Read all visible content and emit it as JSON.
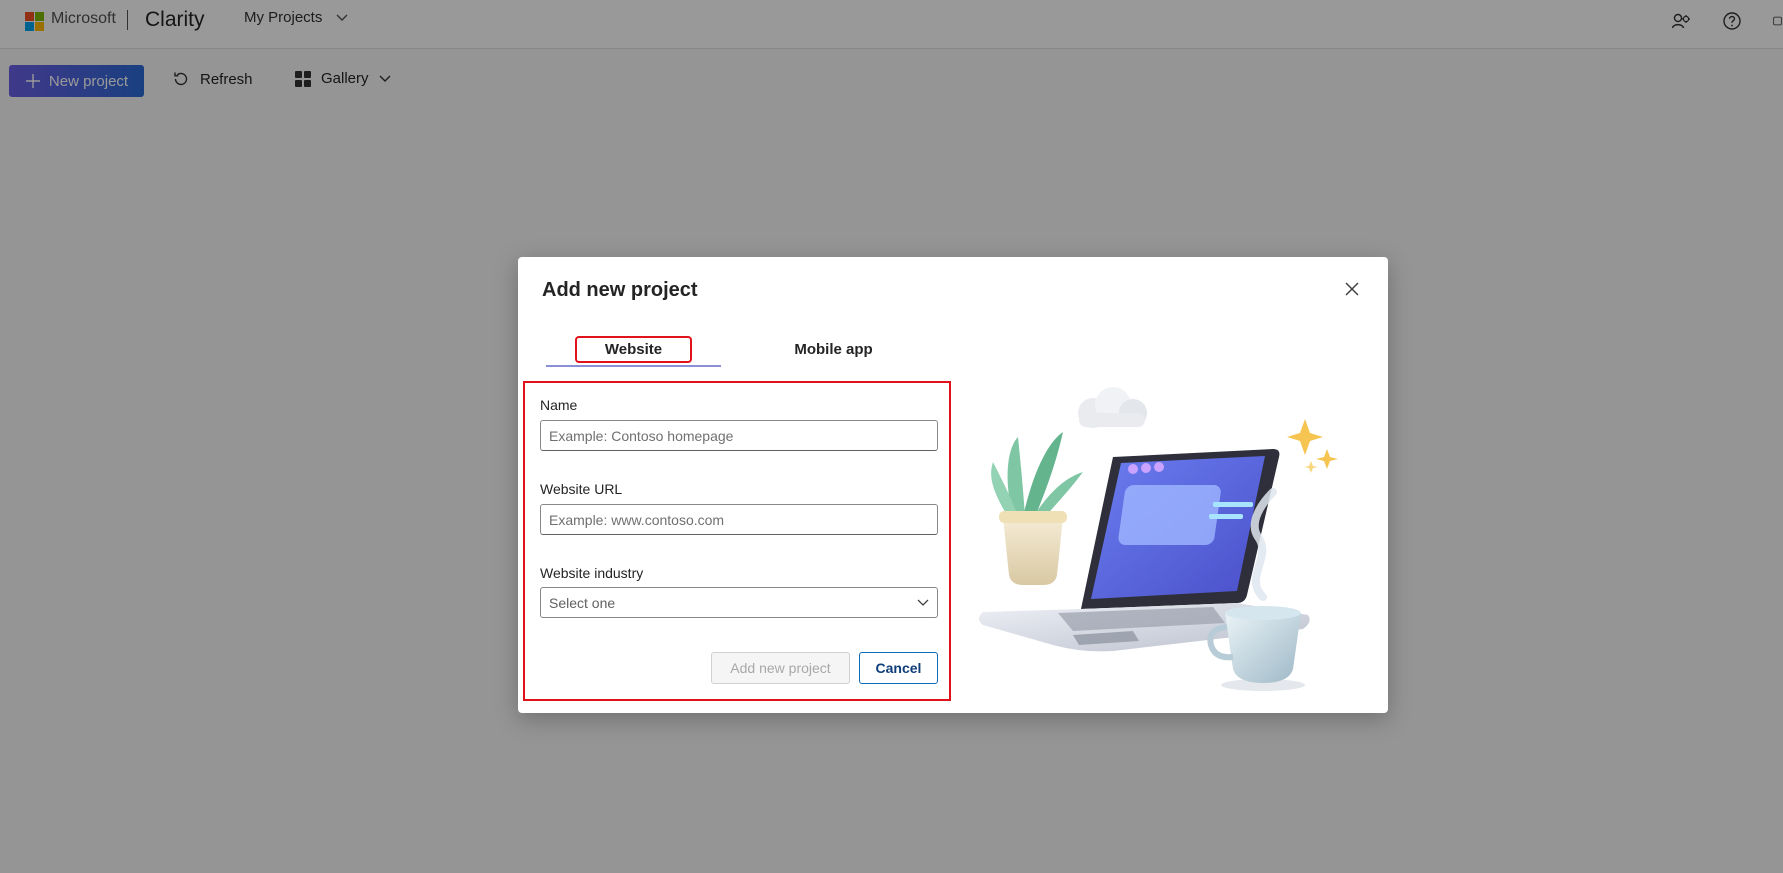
{
  "header": {
    "brand": "Microsoft",
    "product": "Clarity",
    "projects_menu": "My Projects",
    "icons": [
      "account-settings-icon",
      "help-icon",
      "panel-icon"
    ]
  },
  "toolbar": {
    "new_project": "New project",
    "refresh": "Refresh",
    "gallery": "Gallery"
  },
  "dialog": {
    "title": "Add new project",
    "tabs": [
      {
        "label": "Website",
        "selected": true
      },
      {
        "label": "Mobile app",
        "selected": false
      }
    ],
    "fields": {
      "name": {
        "label": "Name",
        "placeholder": "Example: Contoso homepage",
        "value": ""
      },
      "url": {
        "label": "Website URL",
        "placeholder": "Example: www.contoso.com",
        "value": ""
      },
      "industry": {
        "label": "Website industry",
        "selected": "Select one"
      }
    },
    "buttons": {
      "add": "Add new project",
      "cancel": "Cancel"
    }
  },
  "colors": {
    "accent_start": "#6b5fe6",
    "accent_end": "#2b6ad6",
    "highlight_box": "#e0121b",
    "tab_underline": "#8a8fd6",
    "cancel_border": "#0f6cbd"
  }
}
